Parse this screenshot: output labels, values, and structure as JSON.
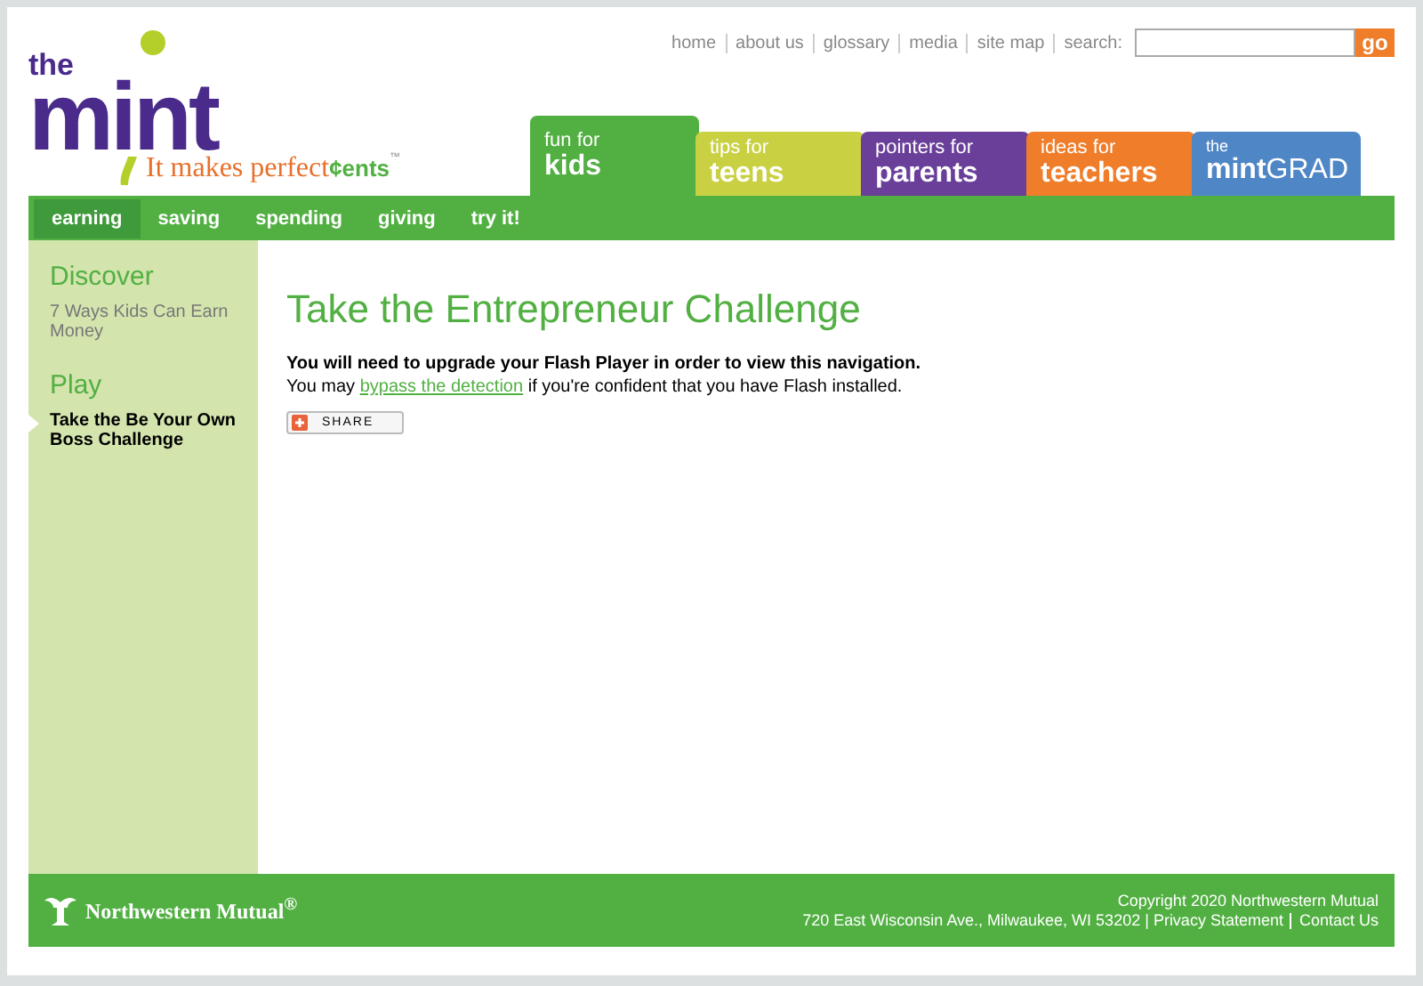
{
  "logo": {
    "small": "the",
    "word": "mint",
    "tagline": "It makes perfect",
    "tagline_brand": "¢ents",
    "trademark": "™"
  },
  "top_links": [
    "home",
    "about us",
    "glossary",
    "media",
    "site map"
  ],
  "search": {
    "label": "search:",
    "button": "go"
  },
  "audience_tabs": [
    {
      "kind": "plain",
      "small": "fun for",
      "big": "kids",
      "color": "#52b043",
      "selected": true
    },
    {
      "kind": "plain",
      "small": "tips for",
      "big": "teens",
      "color": "#c9d143",
      "selected": false
    },
    {
      "kind": "plain",
      "small": "pointers for",
      "big": "parents",
      "color": "#6a3f9a",
      "selected": false
    },
    {
      "kind": "plain",
      "small": "ideas for",
      "big": "teachers",
      "color": "#ef7d2a",
      "selected": false
    },
    {
      "kind": "brand",
      "small": "the",
      "big": "**mint**GRAD",
      "color": "#4f86c6",
      "selected": false
    }
  ],
  "nav": [
    {
      "label": "earning",
      "selected": true
    },
    {
      "label": "saving",
      "selected": false
    },
    {
      "label": "spending",
      "selected": false
    },
    {
      "label": "giving",
      "selected": false
    },
    {
      "label": "try it!",
      "selected": false
    }
  ],
  "sidebar": [
    {
      "heading": "Discover",
      "items": [
        {
          "label": "7 Ways Kids Can Earn Money",
          "selected": false
        }
      ]
    },
    {
      "heading": "Play",
      "items": [
        {
          "label": "Take the Be Your Own Boss Challenge",
          "selected": true
        }
      ]
    }
  ],
  "main": {
    "title": "Take the Entrepreneur Challenge",
    "notice": "You will need to upgrade your Flash Player in order to view this navigation.",
    "line_before": "You may",
    "link": "bypass the detection",
    "line_after": "if you're confident that you have Flash installed.",
    "share": "SHARE"
  },
  "footer": {
    "brand": "Northwestern Mutual$^{®}$",
    "copyright": "Copyright 2020 Northwestern Mutual",
    "address": "720 East Wisconsin Ave., Milwaukee, WI 53202 |",
    "links": [
      "Privacy Statement",
      "Contact Us"
    ]
  }
}
